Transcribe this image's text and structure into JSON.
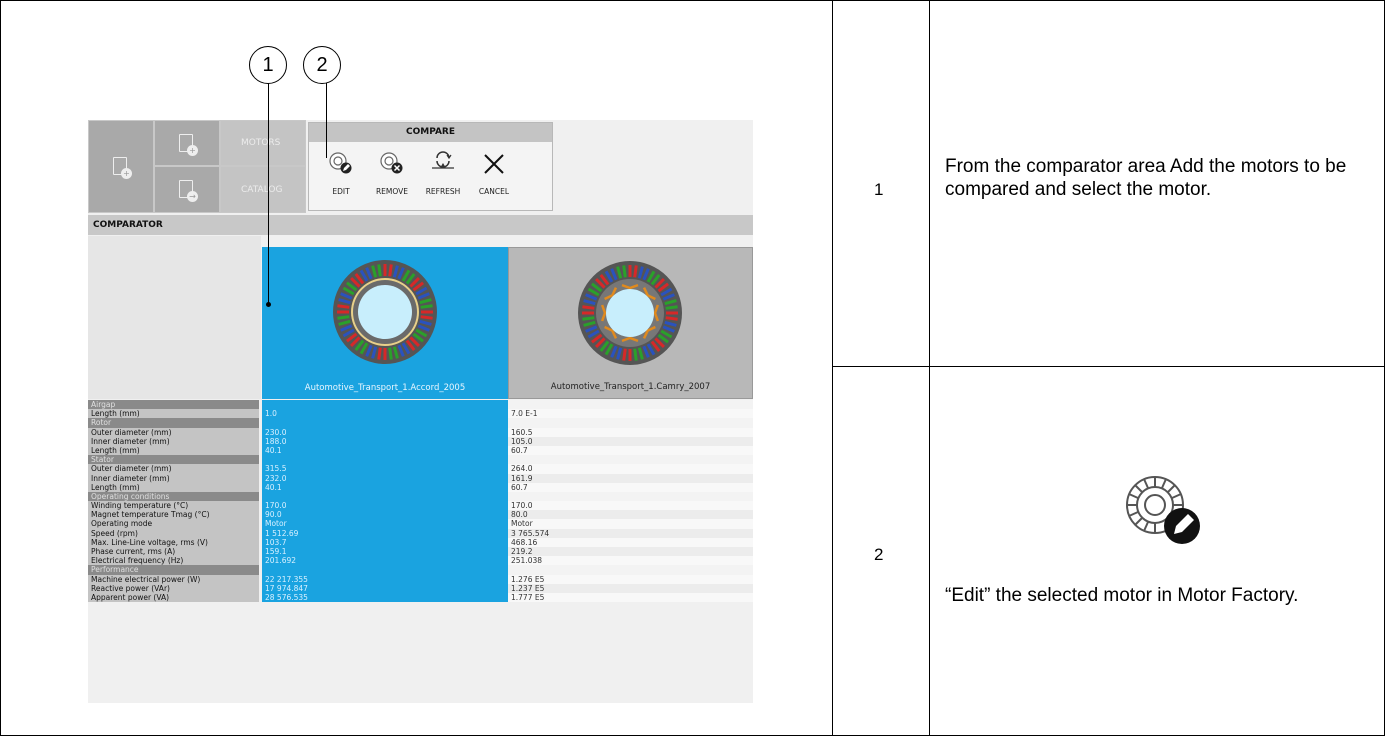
{
  "steps": [
    {
      "number": "1",
      "text": "From the comparator area Add the motors to be compared and select the motor."
    },
    {
      "number": "2",
      "text": "“Edit” the selected motor in Motor Factory."
    }
  ],
  "callouts": [
    "1",
    "2"
  ],
  "ribbon": {
    "motors_label": "MOTORS",
    "catalog_label": "CATALOG",
    "compare_title": "COMPARE",
    "tools": {
      "edit": "EDIT",
      "remove": "REMOVE",
      "refresh": "REFRESH",
      "cancel": "CANCEL"
    }
  },
  "comparator": {
    "title": "COMPARATOR",
    "motor1_name": "Automotive_Transport_1.Accord_2005",
    "motor2_name": "Automotive_Transport_1.Camry_2007",
    "rows": [
      {
        "label": "Airgap",
        "v1": "",
        "v2": "",
        "section": true
      },
      {
        "label": "Length (mm)",
        "v1": "1.0",
        "v2": "7.0 E-1"
      },
      {
        "label": "Rotor",
        "v1": "",
        "v2": "",
        "section": true
      },
      {
        "label": "Outer diameter (mm)",
        "v1": "230.0",
        "v2": "160.5"
      },
      {
        "label": "Inner diameter (mm)",
        "v1": "188.0",
        "v2": "105.0"
      },
      {
        "label": "Length (mm)",
        "v1": "40.1",
        "v2": "60.7"
      },
      {
        "label": "Stator",
        "v1": "",
        "v2": "",
        "section": true
      },
      {
        "label": "Outer diameter (mm)",
        "v1": "315.5",
        "v2": "264.0"
      },
      {
        "label": "Inner diameter (mm)",
        "v1": "232.0",
        "v2": "161.9"
      },
      {
        "label": "Length (mm)",
        "v1": "40.1",
        "v2": "60.7"
      },
      {
        "label": "Operating conditions",
        "v1": "",
        "v2": "",
        "section": true
      },
      {
        "label": "Winding temperature (°C)",
        "v1": "170.0",
        "v2": "170.0"
      },
      {
        "label": "Magnet temperature Tmag (°C)",
        "v1": "90.0",
        "v2": "80.0"
      },
      {
        "label": "Operating mode",
        "v1": "Motor",
        "v2": "Motor"
      },
      {
        "label": "Speed (rpm)",
        "v1": "1 512.69",
        "v2": "3 765.574"
      },
      {
        "label": "Max. Line-Line voltage, rms (V)",
        "v1": "103.7",
        "v2": "468.16"
      },
      {
        "label": "Phase current, rms (A)",
        "v1": "159.1",
        "v2": "219.2"
      },
      {
        "label": "Electrical frequency (Hz)",
        "v1": "201.692",
        "v2": "251.038"
      },
      {
        "label": "Performance",
        "v1": "",
        "v2": "",
        "section": true
      },
      {
        "label": "Machine electrical power (W)",
        "v1": "22 217.355",
        "v2": "1.276 E5"
      },
      {
        "label": "Reactive power (VAr)",
        "v1": "17 974.847",
        "v2": "1.237 E5"
      },
      {
        "label": "Apparent power (VA)",
        "v1": "28 576.535",
        "v2": "1.777 E5"
      }
    ]
  },
  "icons": {
    "edit": "motor-edit-icon",
    "remove": "motor-remove-icon",
    "refresh": "refresh-icon",
    "cancel": "close-icon"
  }
}
